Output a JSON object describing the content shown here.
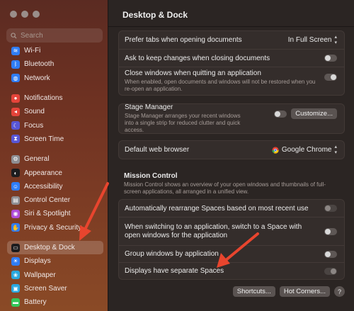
{
  "search": {
    "placeholder": "Search"
  },
  "sidebar": {
    "groups": [
      [
        {
          "label": "Wi-Fi",
          "icon": "wifi-icon",
          "color": "#2f7df6",
          "glyph": "≋"
        },
        {
          "label": "Bluetooth",
          "icon": "bluetooth-icon",
          "color": "#2f7df6",
          "glyph": "ᛒ"
        },
        {
          "label": "Network",
          "icon": "globe-icon",
          "color": "#2f7df6",
          "glyph": "◍"
        }
      ],
      [
        {
          "label": "Notifications",
          "icon": "bell-icon",
          "color": "#e5443a",
          "glyph": "●"
        },
        {
          "label": "Sound",
          "icon": "speaker-icon",
          "color": "#e5443a",
          "glyph": "◂"
        },
        {
          "label": "Focus",
          "icon": "moon-icon",
          "color": "#5856d6",
          "glyph": "☾"
        },
        {
          "label": "Screen Time",
          "icon": "hourglass-icon",
          "color": "#5856d6",
          "glyph": "⧗"
        }
      ],
      [
        {
          "label": "General",
          "icon": "gear-icon",
          "color": "#8e8e93",
          "glyph": "⚙"
        },
        {
          "label": "Appearance",
          "icon": "appearance-icon",
          "color": "#1c1c1e",
          "glyph": "◐"
        },
        {
          "label": "Accessibility",
          "icon": "accessibility-icon",
          "color": "#2f7df6",
          "glyph": "☺"
        },
        {
          "label": "Control Center",
          "icon": "control-center-icon",
          "color": "#8e8e93",
          "glyph": "▤"
        },
        {
          "label": "Siri & Spotlight",
          "icon": "siri-icon",
          "color": "#b04cd8",
          "glyph": "◉"
        },
        {
          "label": "Privacy & Security",
          "icon": "hand-icon",
          "color": "#2f7df6",
          "glyph": "✋"
        }
      ],
      [
        {
          "label": "Desktop & Dock",
          "icon": "dock-icon",
          "color": "#1c1c1e",
          "glyph": "▭",
          "selected": true
        },
        {
          "label": "Displays",
          "icon": "sun-icon",
          "color": "#2f7df6",
          "glyph": "☀"
        },
        {
          "label": "Wallpaper",
          "icon": "wallpaper-icon",
          "color": "#29a8e0",
          "glyph": "❀"
        },
        {
          "label": "Screen Saver",
          "icon": "screensaver-icon",
          "color": "#29a8e0",
          "glyph": "▣"
        },
        {
          "label": "Battery",
          "icon": "battery-icon",
          "color": "#34c759",
          "glyph": "▬"
        }
      ]
    ]
  },
  "main": {
    "title": "Desktop & Dock",
    "windows": {
      "prefer_tabs_label": "Prefer tabs when opening documents",
      "prefer_tabs_value": "In Full Screen",
      "ask_keep_label": "Ask to keep changes when closing documents",
      "close_windows_label": "Close windows when quitting an application",
      "close_windows_desc": "When enabled, open documents and windows will not be restored when you re-open an application."
    },
    "stage": {
      "label": "Stage Manager",
      "desc": "Stage Manager arranges your recent windows into a single strip for reduced clutter and quick access.",
      "customize": "Customize..."
    },
    "browser": {
      "label": "Default web browser",
      "value": "Google Chrome"
    },
    "mission": {
      "title": "Mission Control",
      "desc": "Mission Control shows an overview of your open windows and thumbnails of full-screen applications, all arranged in a unified view.",
      "rearrange_label": "Automatically rearrange Spaces based on most recent use",
      "switch_label": "When switching to an application, switch to a Space with open windows for the application",
      "group_label": "Group windows by application",
      "separate_label": "Displays have separate Spaces"
    },
    "buttons": {
      "shortcuts": "Shortcuts...",
      "hot_corners": "Hot Corners...",
      "help": "?"
    }
  },
  "colors": {
    "arrow": "#e8452e"
  }
}
